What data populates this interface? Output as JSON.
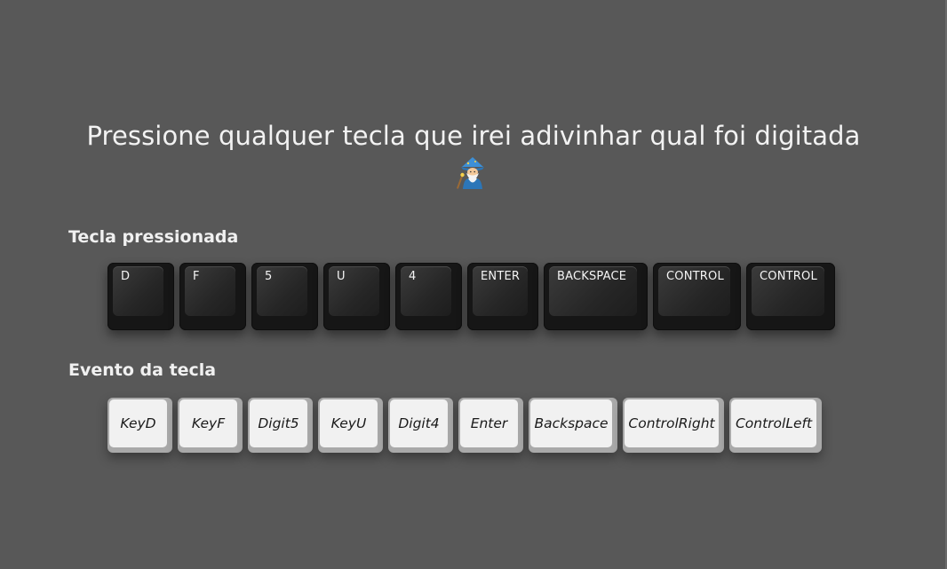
{
  "title": "Pressione qualquer tecla que irei adivinhar qual foi digitada",
  "title_icon": "wizard-emoji",
  "section_pressed_label": "Tecla pressionada",
  "section_event_label": "Evento da tecla",
  "pressed_keys": [
    "D",
    "F",
    "5",
    "U",
    "4",
    "ENTER",
    "BACKSPACE",
    "CONTROL",
    "CONTROL"
  ],
  "event_codes": [
    "KeyD",
    "KeyF",
    "Digit5",
    "KeyU",
    "Digit4",
    "Enter",
    "Backspace",
    "ControlRight",
    "ControlLeft"
  ],
  "colors": {
    "background": "#585858",
    "dark_key": "#161616",
    "light_key": "#f1f1f1"
  }
}
